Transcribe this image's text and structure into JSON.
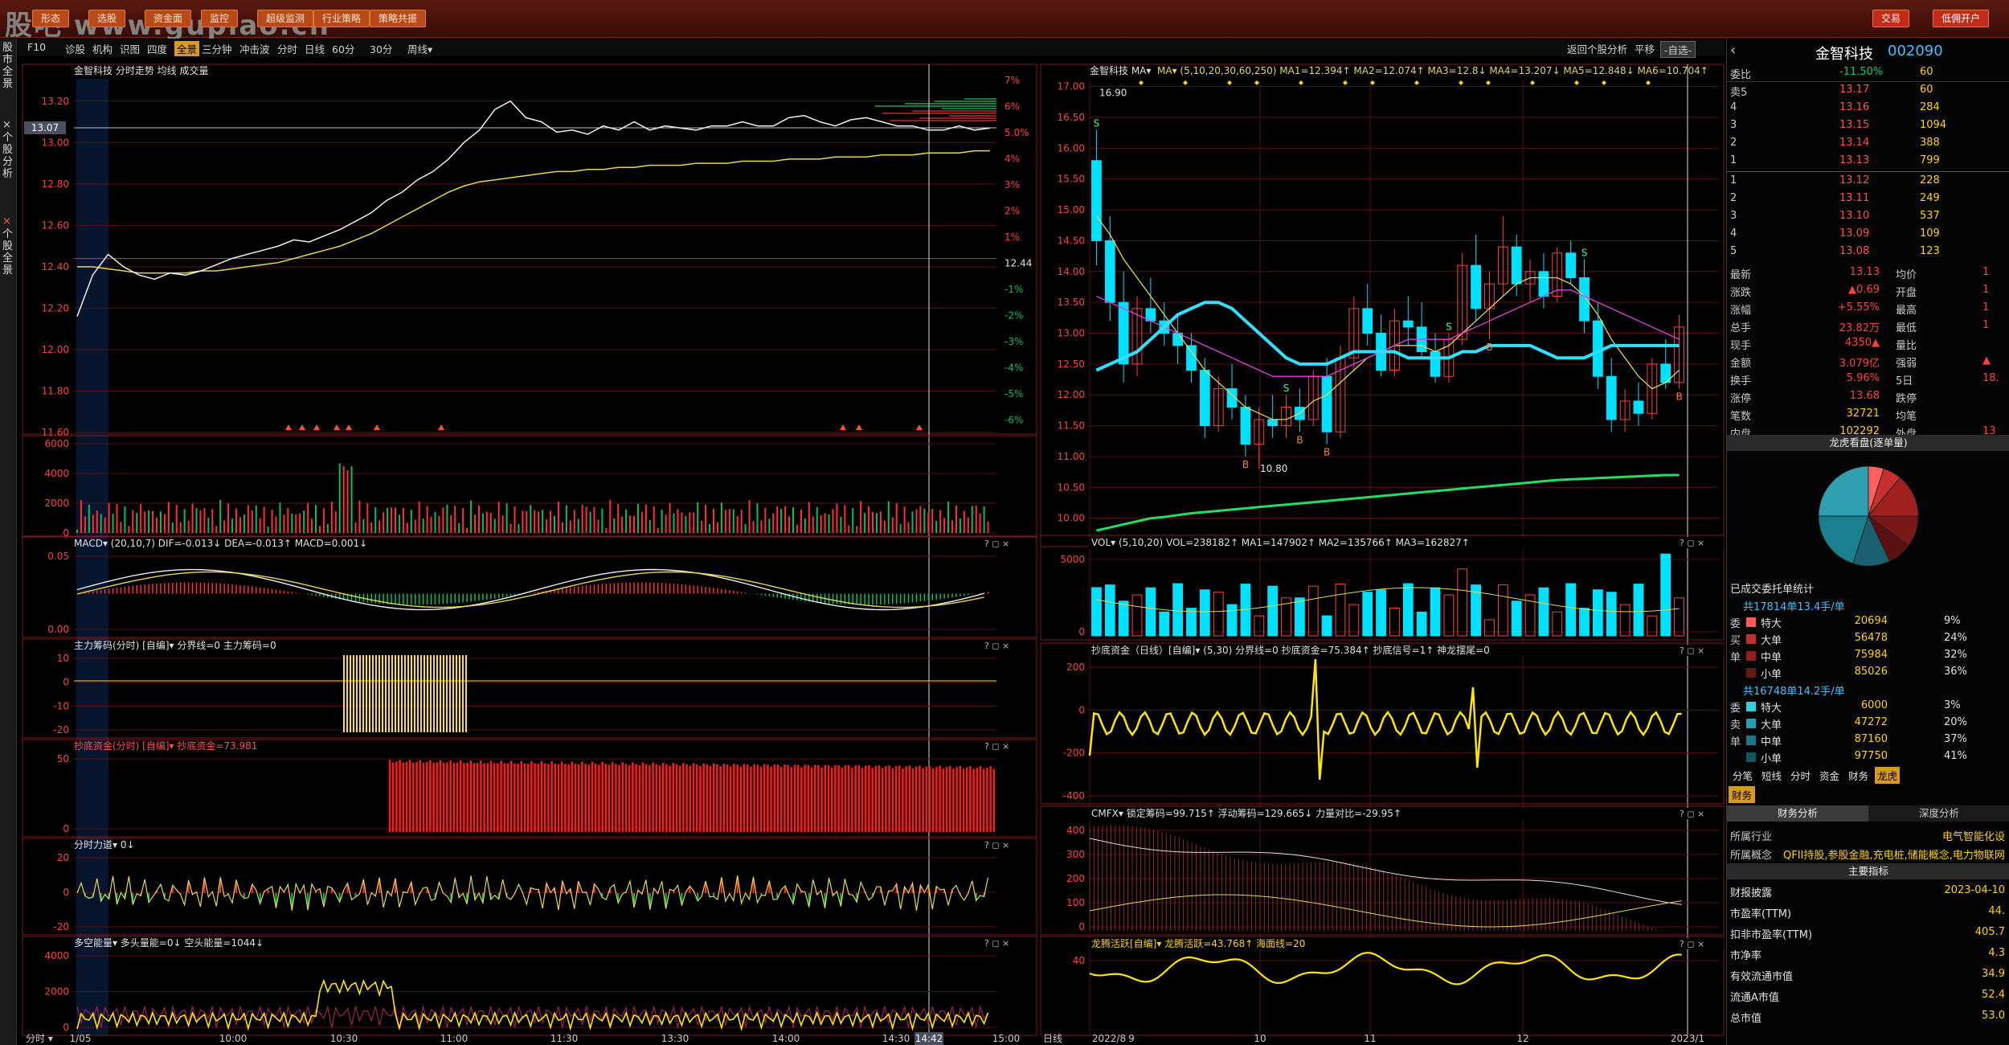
{
  "topbar": {
    "logo": "股吧 www.gupiao.cn",
    "buttons": [
      "形态",
      "选股",
      "资金面",
      "监控",
      "超级监测",
      "行业策略",
      "策略共振"
    ],
    "right_buttons": [
      "交易",
      "低佣开户"
    ]
  },
  "sidetabs": [
    "股市全景",
    "个股分析",
    "个股全景"
  ],
  "toolbar_left": [
    "F10",
    "诊股",
    "机构",
    "识图",
    "四度",
    "全景",
    "三分钟",
    "冲击波",
    "分时",
    "日线",
    "60分",
    "30分",
    "周线▾"
  ],
  "toolbar_active": "全景",
  "toolbar_right": [
    "返回个股分析",
    "平移",
    "-自选-"
  ],
  "intraday": {
    "header": "金智科技  分时走势  均线  成交量",
    "current_price_tag": "13.07",
    "price_ticks": [
      "13.20",
      "13.00",
      "12.80",
      "12.60",
      "12.40",
      "12.20",
      "12.00",
      "11.80",
      "11.60"
    ],
    "pct_ticks": [
      "7%",
      "6%",
      "5.0%",
      "4%",
      "3%",
      "2%",
      "1%",
      "12.44",
      "-1%",
      "-2%",
      "-3%",
      "-4%",
      "-5%",
      "-6%"
    ],
    "vol_ticks": [
      "6000",
      "4000",
      "2000",
      "0"
    ],
    "time_ticks": [
      "1/05",
      "10:00",
      "10:30",
      "11:00",
      "11:30",
      "13:30",
      "14:00",
      "14:30",
      "14:42",
      "15:00"
    ],
    "crosshair_time": "14:42",
    "price_line": [
      12.16,
      12.36,
      12.46,
      12.4,
      12.36,
      12.34,
      12.37,
      12.36,
      12.38,
      12.41,
      12.44,
      12.46,
      12.48,
      12.5,
      12.53,
      12.52,
      12.55,
      12.58,
      12.62,
      12.66,
      12.72,
      12.76,
      12.82,
      12.86,
      12.92,
      13.0,
      13.06,
      13.16,
      13.2,
      13.12,
      13.1,
      13.05,
      13.06,
      13.04,
      13.08,
      13.06,
      13.1,
      13.06,
      13.08,
      13.07,
      13.06,
      13.08,
      13.08,
      13.1,
      13.08,
      13.08,
      13.12,
      13.13,
      13.1,
      13.08,
      13.11,
      13.12,
      13.1,
      13.08,
      13.08,
      13.06,
      13.06,
      13.08,
      13.06,
      13.07
    ],
    "avg_line": [
      12.4,
      12.4,
      12.39,
      12.38,
      12.37,
      12.37,
      12.37,
      12.37,
      12.38,
      12.38,
      12.39,
      12.4,
      12.41,
      12.42,
      12.44,
      12.46,
      12.48,
      12.5,
      12.53,
      12.56,
      12.6,
      12.64,
      12.68,
      12.72,
      12.76,
      12.79,
      12.81,
      12.82,
      12.83,
      12.84,
      12.85,
      12.86,
      12.86,
      12.87,
      12.87,
      12.88,
      12.88,
      12.89,
      12.89,
      12.89,
      12.9,
      12.9,
      12.9,
      12.91,
      12.91,
      12.91,
      12.92,
      12.92,
      12.92,
      12.93,
      12.93,
      12.93,
      12.94,
      12.94,
      12.94,
      12.95,
      12.95,
      12.95,
      12.96,
      12.96
    ]
  },
  "intraday_panels": [
    {
      "title": "MACD▾  (20,10,7)  DIF=-0.013↓ DEA=-0.013↑ MACD=0.001↓",
      "ticks": [
        "0.05",
        "0.00"
      ]
    },
    {
      "title": "主力筹码(分时) [自编]▾  分界线=0 主力筹码=0",
      "ticks": [
        "10",
        "0",
        "-10",
        "-20"
      ]
    },
    {
      "title": "抄底资金(分时) [自编]▾  抄底资金=73.981",
      "ticks": [
        "50",
        "0"
      ]
    },
    {
      "title": "分时力道▾  0↓",
      "ticks": [
        "20",
        "0",
        "-20"
      ]
    },
    {
      "title": "多空能量▾  多头量能=0↓  空头能量=1044↓",
      "ticks": [
        "4000",
        "2000",
        "0"
      ]
    }
  ],
  "daily": {
    "header_name": "金智科技",
    "ma_legend": "MA▾ (5,10,20,30,60,250)  MA1=12.394↑ MA2=12.074↑ MA3=12.8↓ MA4=13.207↓ MA5=12.848↓ MA6=10.704↑",
    "price_ticks": [
      "17.00",
      "16.50",
      "16.00",
      "15.50",
      "15.00",
      "14.50",
      "14.00",
      "13.50",
      "13.00",
      "12.50",
      "12.00",
      "11.50",
      "11.00",
      "10.50",
      "10.00"
    ],
    "high_label": "16.90",
    "low_label": "10.80",
    "date_ticks": [
      "2022/8",
      "9",
      "10",
      "11",
      "12",
      "2023/1"
    ],
    "period_label": "日线",
    "candles": [
      [
        15.8,
        16.3,
        14.1,
        14.5
      ],
      [
        14.5,
        14.9,
        13.2,
        13.5
      ],
      [
        13.5,
        14.0,
        12.2,
        12.5
      ],
      [
        12.5,
        13.6,
        12.3,
        13.4
      ],
      [
        13.4,
        13.9,
        13.0,
        13.2
      ],
      [
        13.2,
        13.5,
        12.8,
        13.0
      ],
      [
        13.0,
        13.3,
        12.5,
        12.8
      ],
      [
        12.8,
        13.0,
        12.2,
        12.4
      ],
      [
        12.4,
        12.6,
        11.3,
        11.5
      ],
      [
        11.5,
        12.3,
        11.4,
        12.1
      ],
      [
        12.1,
        12.5,
        11.6,
        11.8
      ],
      [
        11.8,
        12.0,
        11.0,
        11.2
      ],
      [
        11.2,
        11.8,
        10.8,
        11.6
      ],
      [
        11.6,
        12.0,
        11.3,
        11.5
      ],
      [
        11.5,
        12.0,
        11.3,
        11.8
      ],
      [
        11.8,
        12.1,
        11.4,
        11.6
      ],
      [
        11.6,
        12.4,
        11.5,
        12.3
      ],
      [
        12.3,
        12.6,
        11.2,
        11.4
      ],
      [
        11.4,
        12.8,
        11.3,
        12.6
      ],
      [
        12.6,
        13.6,
        12.4,
        13.4
      ],
      [
        13.4,
        13.8,
        12.8,
        13.0
      ],
      [
        13.0,
        13.3,
        12.3,
        12.4
      ],
      [
        12.4,
        13.4,
        12.3,
        13.2
      ],
      [
        13.2,
        13.6,
        12.8,
        13.1
      ],
      [
        13.1,
        13.5,
        12.6,
        12.7
      ],
      [
        12.7,
        13.0,
        12.2,
        12.3
      ],
      [
        12.3,
        13.0,
        12.2,
        12.9
      ],
      [
        12.9,
        14.3,
        12.8,
        14.1
      ],
      [
        14.1,
        14.6,
        13.2,
        13.4
      ],
      [
        13.4,
        14.0,
        12.9,
        13.8
      ],
      [
        13.8,
        14.9,
        13.6,
        14.4
      ],
      [
        14.4,
        14.6,
        13.6,
        13.8
      ],
      [
        13.8,
        14.2,
        13.5,
        14.0
      ],
      [
        14.0,
        14.3,
        13.4,
        13.6
      ],
      [
        13.6,
        14.4,
        13.5,
        14.3
      ],
      [
        14.3,
        14.5,
        13.8,
        13.9
      ],
      [
        13.9,
        14.2,
        13.0,
        13.2
      ],
      [
        13.2,
        13.5,
        12.1,
        12.3
      ],
      [
        12.3,
        12.6,
        11.4,
        11.6
      ],
      [
        11.6,
        12.1,
        11.4,
        11.9
      ],
      [
        11.9,
        12.2,
        11.5,
        11.7
      ],
      [
        11.7,
        12.6,
        11.6,
        12.5
      ],
      [
        12.5,
        12.9,
        12.1,
        12.2
      ],
      [
        12.2,
        13.3,
        12.1,
        13.1
      ]
    ],
    "ma_a": [
      14.9,
      14.6,
      14.2,
      13.9,
      13.6,
      13.3,
      13.0,
      12.7,
      12.4,
      12.2,
      12.0,
      11.8,
      11.7,
      11.6,
      11.6,
      11.7,
      11.9,
      12.0,
      12.2,
      12.4,
      12.6,
      12.7,
      12.8,
      12.8,
      12.8,
      12.7,
      12.8,
      13.0,
      13.2,
      13.4,
      13.6,
      13.8,
      13.9,
      13.9,
      13.9,
      13.8,
      13.6,
      13.3,
      12.9,
      12.6,
      12.3,
      12.1,
      12.2,
      12.4
    ],
    "ma_b": [
      13.6,
      13.5,
      13.4,
      13.3,
      13.2,
      13.1,
      13.0,
      12.9,
      12.8,
      12.7,
      12.6,
      12.5,
      12.4,
      12.3,
      12.3,
      12.3,
      12.3,
      12.3,
      12.4,
      12.5,
      12.6,
      12.7,
      12.8,
      12.9,
      12.9,
      12.9,
      12.9,
      13.0,
      13.1,
      13.2,
      13.3,
      13.4,
      13.5,
      13.6,
      13.7,
      13.7,
      13.6,
      13.5,
      13.4,
      13.3,
      13.2,
      13.1,
      13.0,
      12.9
    ],
    "ma_cyan": [
      12.4,
      12.5,
      12.6,
      12.7,
      12.9,
      13.1,
      13.3,
      13.4,
      13.5,
      13.5,
      13.4,
      13.2,
      13.0,
      12.8,
      12.6,
      12.5,
      12.5,
      12.5,
      12.6,
      12.7,
      12.7,
      12.7,
      12.7,
      12.6,
      12.6,
      12.6,
      12.6,
      12.7,
      12.7,
      12.8,
      12.8,
      12.8,
      12.8,
      12.7,
      12.6,
      12.6,
      12.6,
      12.7,
      12.8,
      12.8,
      12.8,
      12.8,
      12.8,
      12.8
    ],
    "ma_green": [
      9.8,
      9.85,
      9.9,
      9.95,
      10.0,
      10.02,
      10.05,
      10.08,
      10.1,
      10.12,
      10.14,
      10.16,
      10.18,
      10.2,
      10.22,
      10.24,
      10.26,
      10.28,
      10.3,
      10.32,
      10.34,
      10.36,
      10.38,
      10.4,
      10.42,
      10.44,
      10.46,
      10.48,
      10.5,
      10.52,
      10.54,
      10.56,
      10.58,
      10.6,
      10.62,
      10.63,
      10.64,
      10.65,
      10.66,
      10.67,
      10.68,
      10.69,
      10.7,
      10.7
    ],
    "signals": [
      {
        "i": 0,
        "t": "S"
      },
      {
        "i": 11,
        "t": "B"
      },
      {
        "i": 14,
        "t": "S"
      },
      {
        "i": 15,
        "t": "B"
      },
      {
        "i": 17,
        "t": "B"
      },
      {
        "i": 26,
        "t": "S"
      },
      {
        "i": 29,
        "t": "B"
      },
      {
        "i": 36,
        "t": "S"
      },
      {
        "i": 43,
        "t": "B"
      }
    ]
  },
  "daily_panels": [
    {
      "title": "VOL▾  (5,10,20)  VOL=238182↑ MA1=147902↑ MA2=135766↑ MA3=162827↑",
      "ticks": [
        "5000",
        "0"
      ]
    },
    {
      "title": "抄底资金（日线）[自编]▾  (5,30)  分界线=0 抄底资金=75.384↑ 抄底信号=1↑ 神龙摆尾=0",
      "ticks": [
        "200",
        "0",
        "-200",
        "-400"
      ]
    },
    {
      "title": "CMFX▾  锁定筹码=99.715↑ 浮动筹码=129.665↓ 力量对比=-29.95↑",
      "ticks": [
        "400",
        "300",
        "200",
        "100",
        "0"
      ]
    },
    {
      "title": "龙腾活跃[自编]▾  龙腾活跃=43.768↑ 海面线=20",
      "ticks": [
        "40"
      ]
    }
  ],
  "right": {
    "name": "金智科技",
    "code": "002090",
    "webi_label": "委比",
    "webi": "-11.50%",
    "webi_vol": "60",
    "sell": [
      {
        "l": "卖5",
        "p": "13.17",
        "v": "60"
      },
      {
        "l": "4",
        "p": "13.16",
        "v": "284"
      },
      {
        "l": "3",
        "p": "13.15",
        "v": "1094"
      },
      {
        "l": "2",
        "p": "13.14",
        "v": "388"
      },
      {
        "l": "1",
        "p": "13.13",
        "v": "799"
      }
    ],
    "buy": [
      {
        "l": "1",
        "p": "13.12",
        "v": "228"
      },
      {
        "l": "2",
        "p": "13.11",
        "v": "249"
      },
      {
        "l": "3",
        "p": "13.10",
        "v": "537"
      },
      {
        "l": "4",
        "p": "13.09",
        "v": "109"
      },
      {
        "l": "5",
        "p": "13.08",
        "v": "123"
      }
    ],
    "stats": [
      {
        "a": "最新",
        "av": "13.13",
        "b": "均价",
        "bv": "1"
      },
      {
        "a": "涨跌",
        "av": "▲0.69",
        "b": "开盘",
        "bv": "1"
      },
      {
        "a": "涨幅",
        "av": "+5.55%",
        "b": "最高",
        "bv": "1"
      },
      {
        "a": "总手",
        "av": "23.82万",
        "b": "最低",
        "bv": "1"
      },
      {
        "a": "现手",
        "av": "4350▲",
        "b": "量比",
        "bv": ""
      },
      {
        "a": "金额",
        "av": "3.079亿",
        "b": "强弱",
        "bv": "▲"
      },
      {
        "a": "换手",
        "av": "5.96%",
        "b": "5日",
        "bv": "18."
      },
      {
        "a": "涨停",
        "av": "13.68",
        "b": "跌停",
        "bv": ""
      },
      {
        "a": "笔数",
        "av": "32721",
        "b": "均笔",
        "bv": ""
      },
      {
        "a": "内盘",
        "av": "102292",
        "b": "外盘",
        "bv": "13"
      }
    ],
    "pie_title": "龙虎看盘(逐单量)",
    "pie_slices": [
      {
        "v": 5,
        "c": "#ff6060"
      },
      {
        "v": 6,
        "c": "#c83030"
      },
      {
        "v": 14,
        "c": "#a02020"
      },
      {
        "v": 10,
        "c": "#7a1818"
      },
      {
        "v": 8,
        "c": "#5a1010"
      },
      {
        "v": 12,
        "c": "#1a6070"
      },
      {
        "v": 20,
        "c": "#1a8090"
      },
      {
        "v": 25,
        "c": "#30a0b0"
      }
    ],
    "order_stats_title": "已成交委托单统计",
    "buy_summary": "共17814单13.4手/单",
    "buy_rows": [
      {
        "t": "特大",
        "v": "20694",
        "p": "9%"
      },
      {
        "t": "大单",
        "v": "56478",
        "p": "24%"
      },
      {
        "t": "中单",
        "v": "75984",
        "p": "32%"
      },
      {
        "t": "小单",
        "v": "85026",
        "p": "36%"
      }
    ],
    "sell_summary": "共16748单14.2手/单",
    "sell_rows": [
      {
        "t": "特大",
        "v": "6000",
        "p": "3%"
      },
      {
        "t": "大单",
        "v": "47272",
        "p": "20%"
      },
      {
        "t": "中单",
        "v": "87160",
        "p": "37%"
      },
      {
        "t": "小单",
        "v": "97750",
        "p": "41%"
      }
    ],
    "side_labels_buy": [
      "委",
      "买",
      "单"
    ],
    "side_labels_sell": [
      "委",
      "卖",
      "单"
    ],
    "tabs": [
      "分笔",
      "短线",
      "分时",
      "资金",
      "财务",
      "龙虎"
    ],
    "tabs_active": "龙虎",
    "fin_tab": "财务",
    "fin_subtabs": [
      "财务分析",
      "深度分析"
    ],
    "industry_label": "所属行业",
    "industry": "电气智能化设",
    "concept_label": "所属概念",
    "concept": "QFII持股,参股金融,充电桩,储能概念,电力物联网",
    "main_index": "主要指标",
    "fin_rows": [
      {
        "k": "财报披露",
        "v": "2023-04-10"
      },
      {
        "k": "市盈率(TTM)",
        "v": "44."
      },
      {
        "k": "扣非市盈率(TTM)",
        "v": "405.7"
      },
      {
        "k": "市净率",
        "v": "4.3"
      },
      {
        "k": "有效流通市值",
        "v": "34.9"
      },
      {
        "k": "流通A市值",
        "v": "52.4"
      },
      {
        "k": "总市值",
        "v": "53.0"
      }
    ]
  }
}
